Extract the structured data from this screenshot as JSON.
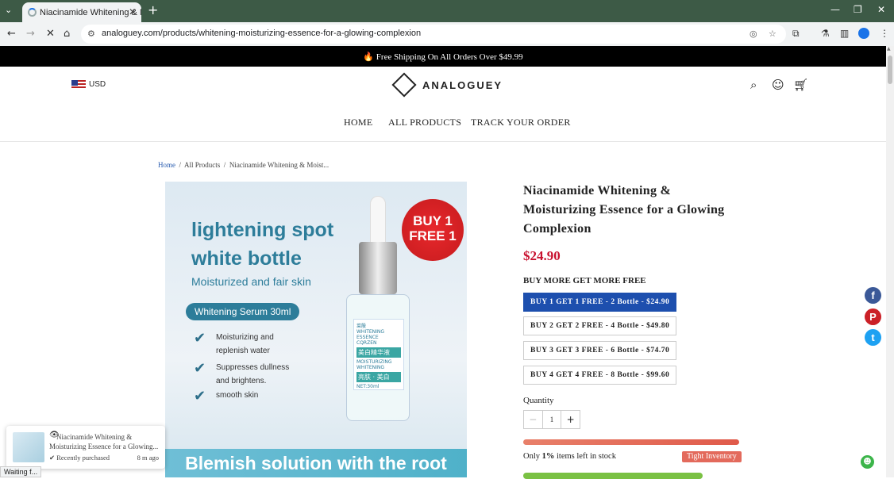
{
  "browser": {
    "tab_title": "Niacinamide Whitening & Moi...",
    "url": "analoguey.com/products/whitening-moisturizing-essence-for-a-glowing-complexion",
    "status_text": "Waiting f..."
  },
  "promo": {
    "text": "🔥 Free Shipping On All Orders Over $49.99"
  },
  "header": {
    "currency": "USD",
    "logo_text": "ANALOGUEY",
    "nav": [
      "HOME",
      "ALL PRODUCTS",
      "TRACK YOUR ORDER"
    ]
  },
  "breadcrumb": {
    "home": "Home",
    "sep": "/",
    "all": "All Products",
    "current": "Niacinamide Whitening & Moist..."
  },
  "product_image": {
    "headline1": "lightening spot",
    "headline2": "white bottle",
    "subline": "Moisturized and fair skin",
    "pill": "Whitening Serum 30ml",
    "features": [
      "Moisturizing and",
      "replenish water",
      "Suppresses dullness",
      "and brightens.",
      "smooth skin"
    ],
    "badge_line1": "BUY 1",
    "badge_line2": "FREE 1",
    "bottle_brand": "菜殷",
    "bottle_name": "WHITENING ESSENCE",
    "bottle_brand_latin": "CQRZEN",
    "bottle_cn": "美白精华液",
    "bottle_line": "MOISTURIZING WHITENING",
    "bottle_green": "亮肤 · 美白",
    "bottle_net": "NET:30ml",
    "banner": "Blemish solution with the root"
  },
  "product": {
    "title": "Niacinamide Whitening & Moisturizing Essence for a Glowing Complexion",
    "price": "$24.90",
    "offer_heading": "BUY MORE GET MORE FREE",
    "options": [
      "BUY 1 GET 1 FREE - 2 Bottle - $24.90",
      "BUY 2 GET 2 FREE - 4 Bottle - $49.80",
      "BUY 3 GET 3 FREE - 6 Bottle - $74.70",
      "BUY 4 GET 4 FREE - 8 Bottle - $99.60"
    ],
    "selected_option": 0,
    "quantity_label": "Quantity",
    "quantity_value": "1",
    "stock_text_prefix": "Only ",
    "stock_count": "1%",
    "stock_text_suffix": " items left in stock",
    "stock_badge": "Tight Inventory"
  },
  "toast": {
    "product": "Niacinamide Whitening & Moisturizing Essence for a Glowing...",
    "status": "Recently purchased",
    "ago": "8 m ago"
  },
  "colors": {
    "accent_blue": "#1d4fae",
    "price_red": "#c8102e",
    "stock_badge": "#e36a5c",
    "promo_bg": "#000000"
  }
}
